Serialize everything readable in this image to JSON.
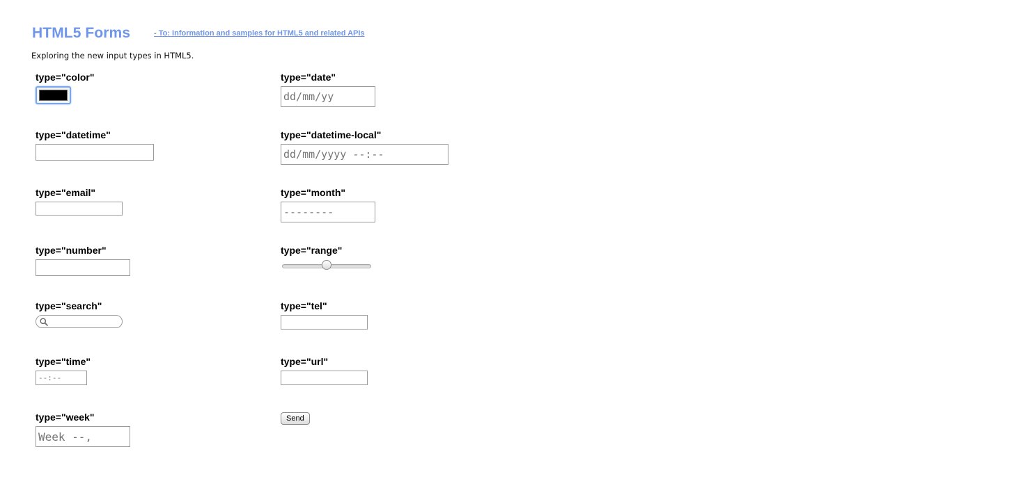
{
  "header": {
    "title": "HTML5 Forms",
    "link_text": "- To: Information and samples for HTML5 and related APIs"
  },
  "intro": "Exploring the new input types in HTML5.",
  "colors": {
    "accent": "#6f96e9",
    "focus_ring": "#7aa7ea",
    "color_value": "#000000"
  },
  "fields": {
    "color": {
      "label": "type=\"color\""
    },
    "date": {
      "label": "type=\"date\"",
      "placeholder": "dd/mm/yy"
    },
    "datetime": {
      "label": "type=\"datetime\"",
      "value": ""
    },
    "datetime_local": {
      "label": "type=\"datetime-local\"",
      "placeholder": "dd/mm/yyyy --:--"
    },
    "email": {
      "label": "type=\"email\"",
      "value": ""
    },
    "month": {
      "label": "type=\"month\"",
      "placeholder": "--------"
    },
    "number": {
      "label": "type=\"number\"",
      "value": ""
    },
    "range": {
      "label": "type=\"range\"",
      "value": 0.5
    },
    "search": {
      "label": "type=\"search\"",
      "icon": "search-icon",
      "value": ""
    },
    "tel": {
      "label": "type=\"tel\"",
      "value": ""
    },
    "time": {
      "label": "type=\"time\"",
      "placeholder": "--:--"
    },
    "url": {
      "label": "type=\"url\"",
      "value": ""
    },
    "week": {
      "label": "type=\"week\"",
      "placeholder": "Week --,"
    }
  },
  "send_label": "Send"
}
